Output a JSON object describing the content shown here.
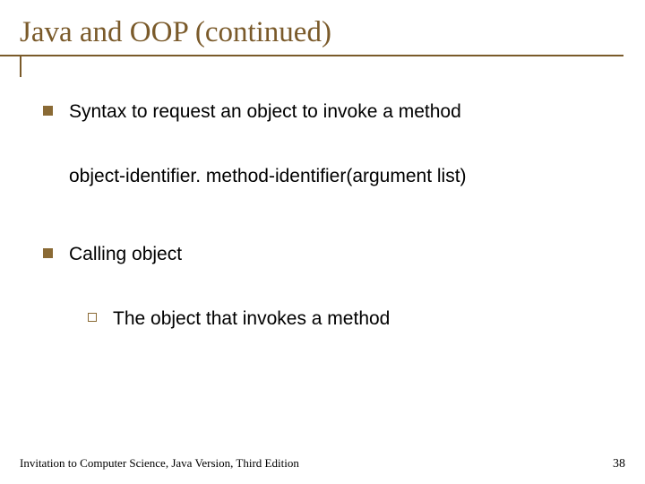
{
  "title": "Java and OOP (continued)",
  "bullets": {
    "item1": "Syntax to request an object to invoke a method",
    "syntax": "object-identifier. method-identifier(argument list)",
    "item2": "Calling object",
    "sub1": "The object that invokes a method"
  },
  "footer": {
    "left": "Invitation to Computer Science, Java Version, Third Edition",
    "page": "38"
  }
}
